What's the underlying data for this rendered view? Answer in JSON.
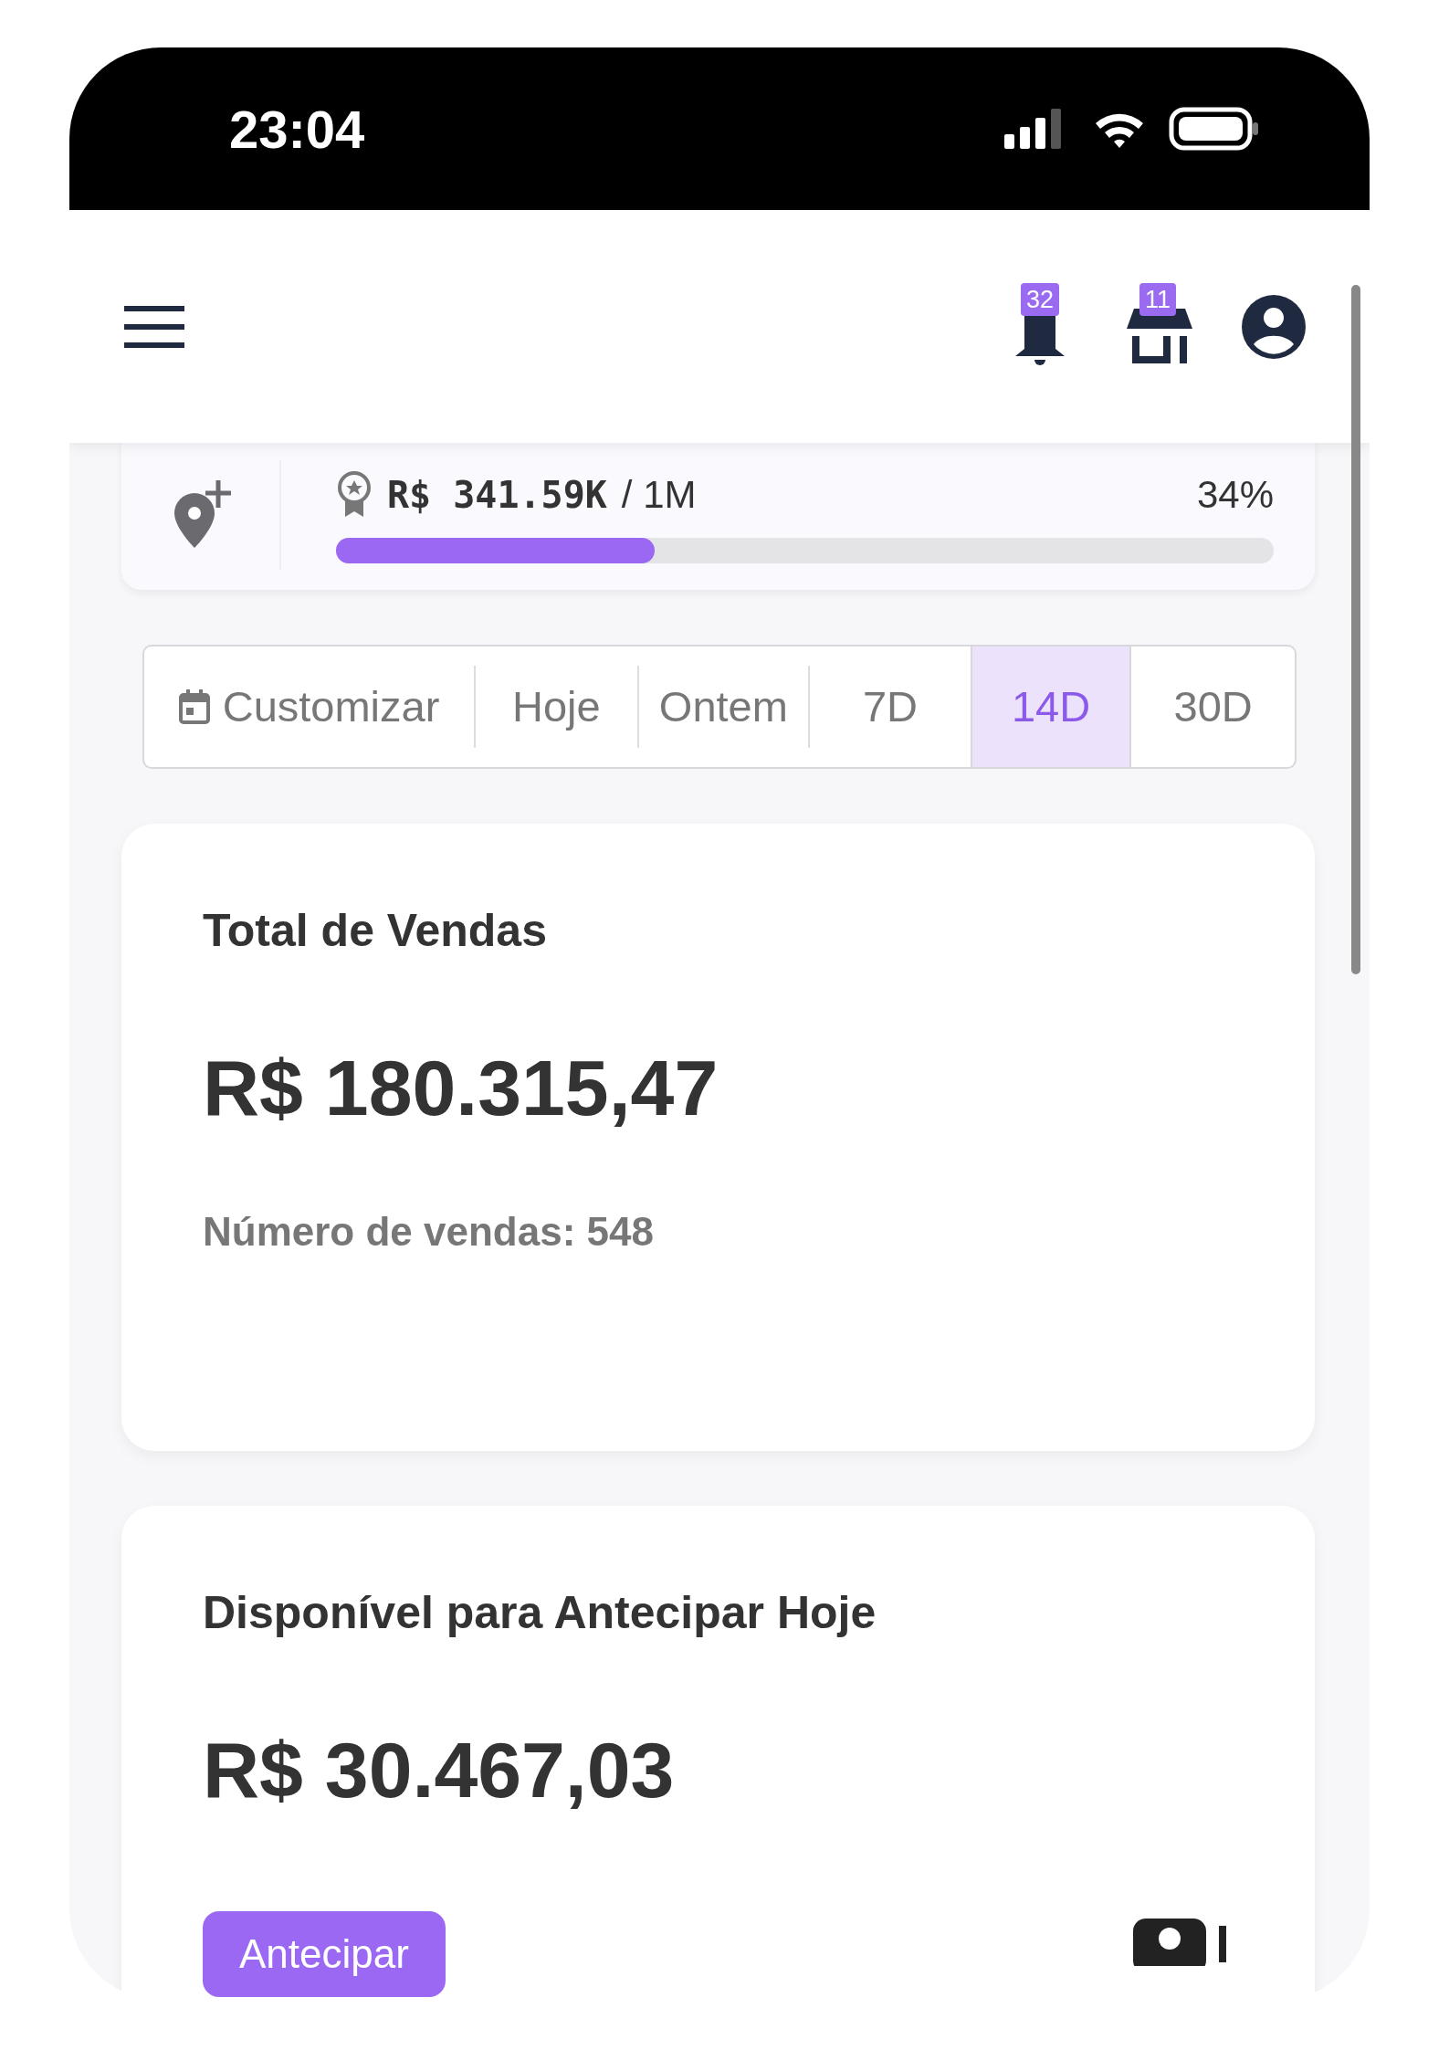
{
  "status_bar": {
    "time": "23:04"
  },
  "header": {
    "notification_count": "32",
    "store_count": "11"
  },
  "goal": {
    "amount": "R$ 341.59K",
    "target": "/ 1M",
    "percent": "34%",
    "level": 0.34
  },
  "periods": [
    {
      "label": "Customizar",
      "kind": "calendar",
      "selected": false
    },
    {
      "label": "Hoje",
      "kind": "text",
      "selected": false
    },
    {
      "label": "Ontem",
      "kind": "text",
      "selected": false
    },
    {
      "label": "7D",
      "kind": "text",
      "selected": false
    },
    {
      "label": "14D",
      "kind": "text",
      "selected": true
    },
    {
      "label": "30D",
      "kind": "text",
      "selected": false
    }
  ],
  "cards": [
    {
      "title": "Total de Vendas",
      "value": "R$ 180.315,47",
      "note": "Número de vendas: 548"
    },
    {
      "title": "Disponível para Antecipar Hoje",
      "value": "R$ 30.467,03",
      "button": "Antecipar"
    }
  ]
}
